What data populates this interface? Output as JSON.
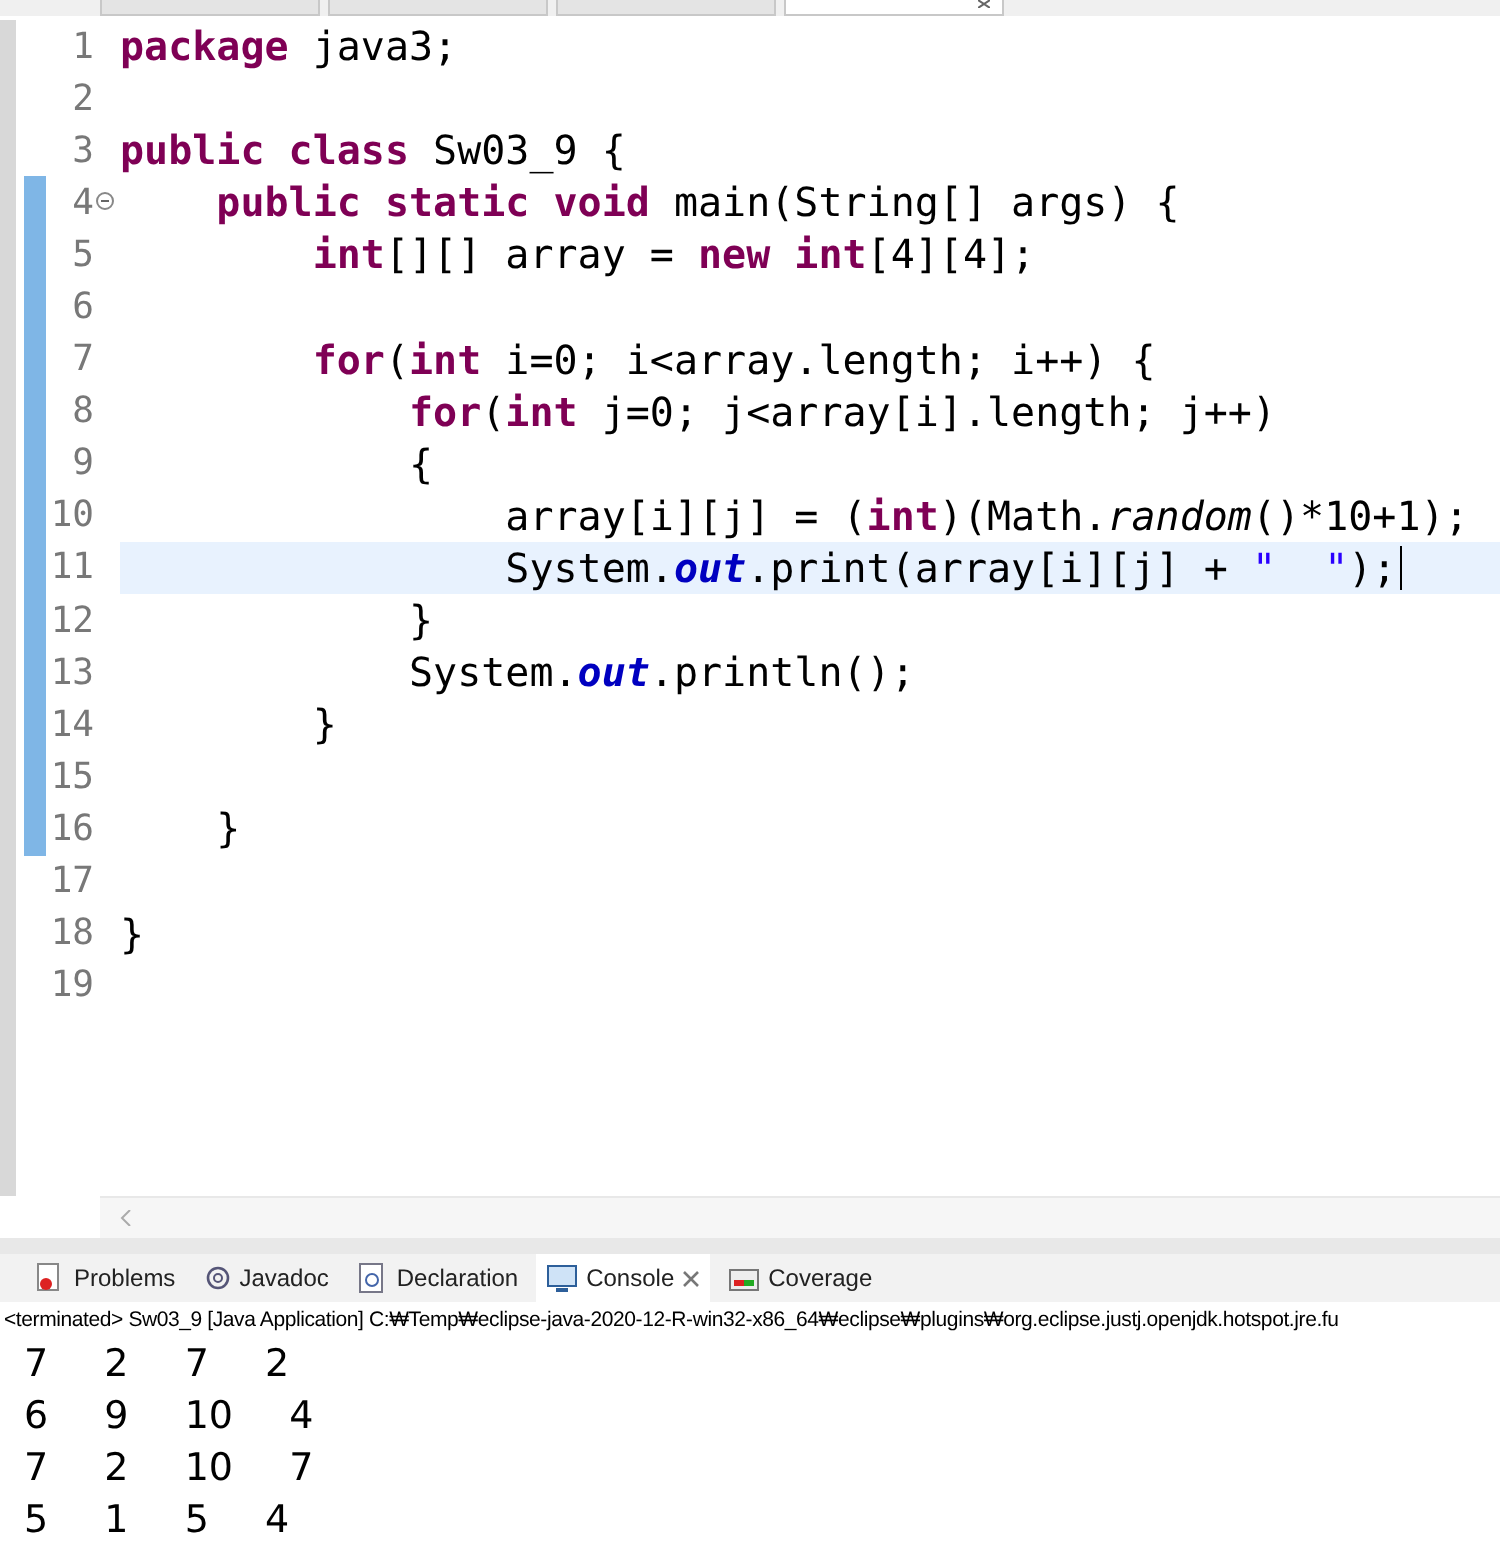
{
  "editor": {
    "tabs": [
      {
        "selected": false
      },
      {
        "selected": false
      },
      {
        "selected": false
      },
      {
        "selected": true
      }
    ],
    "lines": [
      {
        "number": "1",
        "changed": false,
        "fold": false,
        "current": false,
        "tokens": [
          {
            "kind": "kw",
            "text": "package"
          },
          {
            "kind": "plain",
            "text": " java3;"
          }
        ]
      },
      {
        "number": "2",
        "changed": false,
        "fold": false,
        "current": false
      },
      {
        "number": "3",
        "changed": false,
        "fold": false,
        "current": false,
        "tokens": [
          {
            "kind": "kw",
            "text": "public"
          },
          {
            "kind": "kw",
            "text": " class"
          },
          {
            "kind": "plain",
            "text": " Sw03_9 {"
          }
        ]
      },
      {
        "number": "4",
        "changed": true,
        "fold": true,
        "current": false,
        "tokens": [
          {
            "kind": "kw",
            "text": "    public"
          },
          {
            "kind": "kw",
            "text": " static"
          },
          {
            "kind": "kw",
            "text": " void"
          },
          {
            "kind": "plain",
            "text": " main(String[] args) {"
          }
        ]
      },
      {
        "number": "5",
        "changed": true,
        "fold": false,
        "current": false,
        "tokens": [
          {
            "kind": "kw",
            "text": "        int"
          },
          {
            "kind": "plain",
            "text": "[][] array = "
          },
          {
            "kind": "kw",
            "text": "new"
          },
          {
            "kind": "kw",
            "text": " int"
          },
          {
            "kind": "plain",
            "text": "[4][4];"
          }
        ]
      },
      {
        "number": "6",
        "changed": true,
        "fold": false,
        "current": false
      },
      {
        "number": "7",
        "changed": true,
        "fold": false,
        "current": false,
        "tokens": [
          {
            "kind": "kw",
            "text": "        for"
          },
          {
            "kind": "plain",
            "text": "("
          },
          {
            "kind": "kw",
            "text": "int"
          },
          {
            "kind": "plain",
            "text": " i=0; i<array.length; i++) {"
          }
        ]
      },
      {
        "number": "8",
        "changed": true,
        "fold": false,
        "current": false,
        "tokens": [
          {
            "kind": "kw",
            "text": "            for"
          },
          {
            "kind": "plain",
            "text": "("
          },
          {
            "kind": "kw",
            "text": "int"
          },
          {
            "kind": "plain",
            "text": " j=0; j<array[i].length; j++)"
          }
        ]
      },
      {
        "number": "9",
        "changed": true,
        "fold": false,
        "current": false,
        "tokens": [
          {
            "kind": "plain",
            "text": "            {"
          }
        ]
      },
      {
        "number": "10",
        "changed": true,
        "fold": false,
        "current": false,
        "tokens": [
          {
            "kind": "plain",
            "text": "                array[i][j] = ("
          },
          {
            "kind": "kw",
            "text": "int"
          },
          {
            "kind": "plain",
            "text": ")(Math."
          },
          {
            "kind": "static",
            "text": "random"
          },
          {
            "kind": "plain",
            "text": "()*10+1);"
          }
        ]
      },
      {
        "number": "11",
        "changed": true,
        "fold": false,
        "current": true,
        "tokens": [
          {
            "kind": "plain",
            "text": "                System."
          },
          {
            "kind": "field",
            "text": "out"
          },
          {
            "kind": "plain",
            "text": ".print(array[i][j] + "
          },
          {
            "kind": "str",
            "text": "\"  \""
          },
          {
            "kind": "plain",
            "text": ");"
          }
        ]
      },
      {
        "number": "12",
        "changed": true,
        "fold": false,
        "current": false,
        "tokens": [
          {
            "kind": "plain",
            "text": "            }"
          }
        ]
      },
      {
        "number": "13",
        "changed": true,
        "fold": false,
        "current": false,
        "tokens": [
          {
            "kind": "plain",
            "text": "            System."
          },
          {
            "kind": "field",
            "text": "out"
          },
          {
            "kind": "plain",
            "text": ".println();"
          }
        ]
      },
      {
        "number": "14",
        "changed": true,
        "fold": false,
        "current": false,
        "tokens": [
          {
            "kind": "plain",
            "text": "        }"
          }
        ]
      },
      {
        "number": "15",
        "changed": true,
        "fold": false,
        "current": false
      },
      {
        "number": "16",
        "changed": true,
        "fold": false,
        "current": false,
        "tokens": [
          {
            "kind": "plain",
            "text": "    }"
          }
        ]
      },
      {
        "number": "17",
        "changed": false,
        "fold": false,
        "current": false
      },
      {
        "number": "18",
        "changed": false,
        "fold": false,
        "current": false,
        "tokens": [
          {
            "kind": "plain",
            "text": "}"
          }
        ]
      },
      {
        "number": "19",
        "changed": false,
        "fold": false,
        "current": false
      }
    ]
  },
  "views": {
    "tabs": [
      {
        "kind": "problems",
        "label": "Problems",
        "selected": false
      },
      {
        "kind": "javadoc",
        "label": "Javadoc",
        "selected": false
      },
      {
        "kind": "declaration",
        "label": "Declaration",
        "selected": false
      },
      {
        "kind": "console",
        "label": "Console",
        "selected": true
      },
      {
        "kind": "coverage",
        "label": "Coverage",
        "selected": false
      }
    ]
  },
  "console": {
    "status": "<terminated> Sw03_9 [Java Application] C:₩Temp₩eclipse-java-2020-12-R-win32-x86_64₩eclipse₩plugins₩org.eclipse.justj.openjdk.hotspot.jre.fu",
    "output": [
      "7  2  7  2",
      "6  9  10  4",
      "7  2  10  7",
      "5  1  5  4"
    ]
  }
}
